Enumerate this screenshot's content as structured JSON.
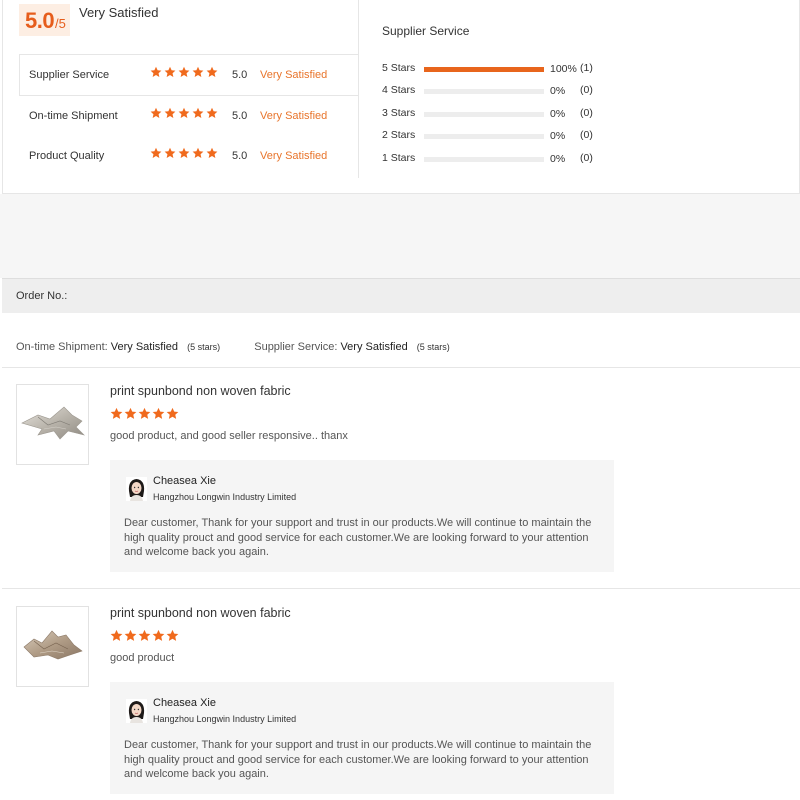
{
  "summary": {
    "score": "5.0",
    "score_denominator": "/5",
    "score_label": "Very Satisfied",
    "rows": [
      {
        "name": "Supplier Service",
        "stars": 5,
        "score": "5.0",
        "label": "Very Satisfied"
      },
      {
        "name": "On-time Shipment",
        "stars": 5,
        "score": "5.0",
        "label": "Very Satisfied"
      },
      {
        "name": "Product Quality",
        "stars": 5,
        "score": "5.0",
        "label": "Very Satisfied"
      }
    ],
    "distribution_title": "Supplier Service",
    "distribution": [
      {
        "label": "5 Stars",
        "fraction": 1.0,
        "percent": "100%",
        "count": "(1)"
      },
      {
        "label": "4 Stars",
        "fraction": 0,
        "percent": "0%",
        "count": "(0)"
      },
      {
        "label": "3 Stars",
        "fraction": 0,
        "percent": "0%",
        "count": "(0)"
      },
      {
        "label": "2 Stars",
        "fraction": 0,
        "percent": "0%",
        "count": "(0)"
      },
      {
        "label": "1 Stars",
        "fraction": 0,
        "percent": "0%",
        "count": "(0)"
      }
    ]
  },
  "order": {
    "label": "Order No.:",
    "shipment_label": "On-time Shipment:",
    "shipment_value": "Very Satisfied",
    "shipment_stars": "(5 stars)",
    "service_label": "Supplier Service:",
    "service_value": "Very Satisfied",
    "service_stars": "(5 stars)"
  },
  "reviews": [
    {
      "title": "print spunbond non woven fabric",
      "stars": 5,
      "text": "good product, and good seller responsive.. thanx",
      "reply": {
        "name": "Cheasea Xie",
        "company": "Hangzhou Longwin Industry Limited",
        "message": "Dear customer, Thank for your  support and trust in our products.We will continue to maintain  the high quality prouct and good service for each customer.We are looking forward to your attention and welcome back you again."
      }
    },
    {
      "title": "print spunbond non woven fabric",
      "stars": 5,
      "text": "good product",
      "reply": {
        "name": "Cheasea Xie",
        "company": "Hangzhou Longwin Industry Limited",
        "message": "Dear customer, Thank for your  support and trust in our products.We will continue to maintain  the high quality prouct and good service for each customer.We are looking forward to your attention and welcome back you again."
      }
    }
  ],
  "colors": {
    "accent": "#e8651c",
    "star": "#f06a1d",
    "score_bg": "#fdeee3"
  },
  "icons": {
    "star": "star-icon",
    "avatar": "avatar-icon"
  }
}
